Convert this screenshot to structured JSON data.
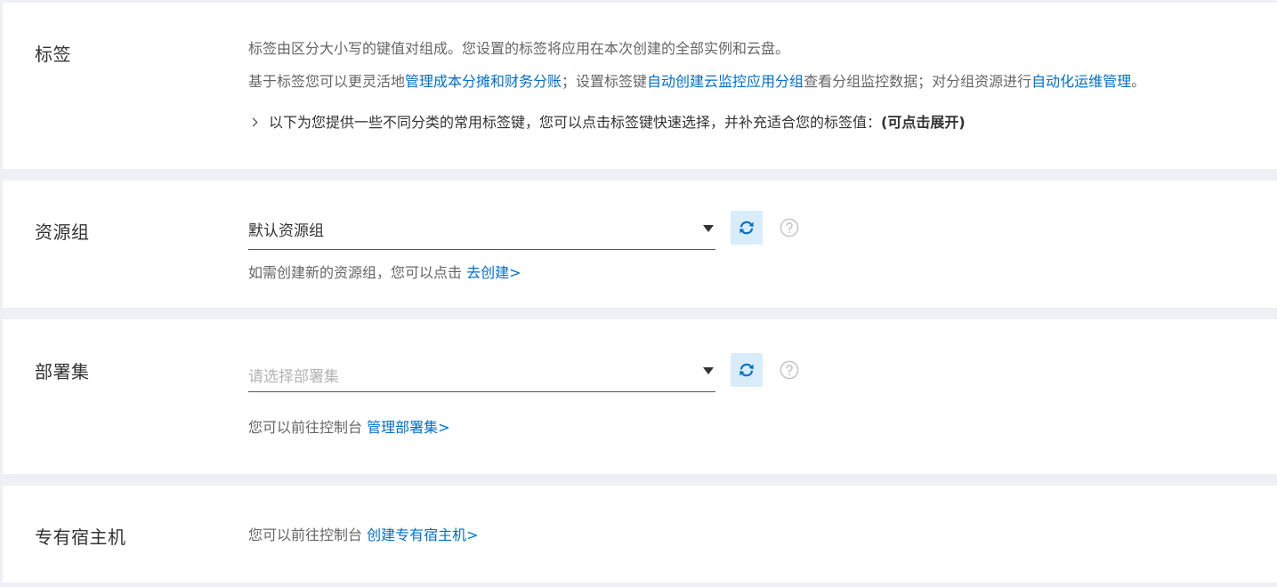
{
  "tags": {
    "label": "标签",
    "line1": "标签由区分大小写的键值对组成。您设置的标签将应用在本次创建的全部实例和云盘。",
    "line2_prefix": "基于标签您可以更灵活地",
    "line2_link1": "管理成本分摊和财务分账",
    "line2_mid": "；设置标签键",
    "line2_link2": "自动创建云监控应用分组",
    "line2_mid2": "查看分组监控数据；对分组资源进行",
    "line2_link3": "自动化运维管理",
    "line2_suffix": "。",
    "expand_text": "以下为您提供一些不同分类的常用标签键，您可以点击标签键快速选择，并补充适合您的标签值：",
    "expand_hint": "(可点击展开)"
  },
  "resource_group": {
    "label": "资源组",
    "selected": "默认资源组",
    "hint_prefix": "如需创建新的资源组，您可以点击 ",
    "hint_link": "去创建>"
  },
  "deployment_set": {
    "label": "部署集",
    "placeholder": "请选择部署集",
    "hint_prefix": "您可以前往控制台 ",
    "hint_link": "管理部署集>"
  },
  "dedicated_host": {
    "label": "专有宿主机",
    "hint_prefix": "您可以前往控制台 ",
    "hint_link": "创建专有宿主机>"
  },
  "icons": {
    "refresh": "refresh-icon",
    "help": "question-circle-icon",
    "dropdown": "caret-down-icon",
    "expand": "chevron-right-icon"
  },
  "colors": {
    "link": "#0070cc",
    "refresh_bg": "#d9ecfa",
    "page_bg": "#eff0f5"
  }
}
